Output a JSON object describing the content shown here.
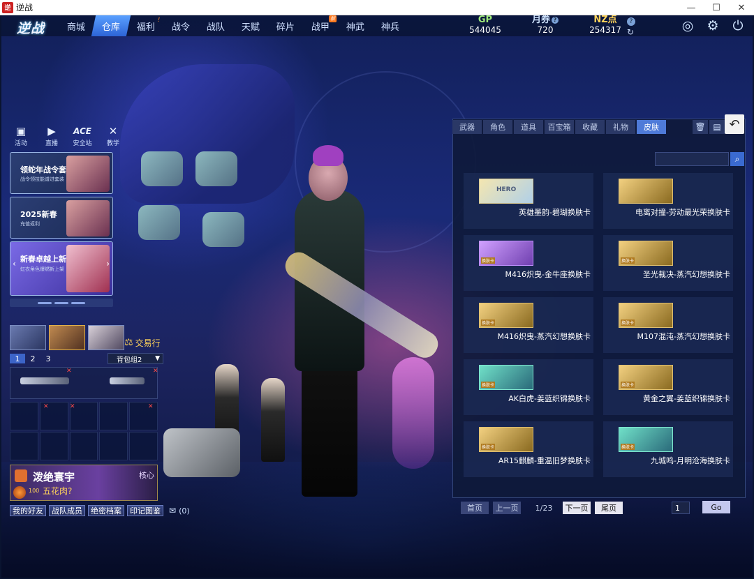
{
  "window": {
    "title": "逆战",
    "logo_glyph": "逆"
  },
  "nav": {
    "logo": "逆战",
    "tabs": [
      {
        "label": "商城"
      },
      {
        "label": "仓库"
      },
      {
        "label": "福利",
        "mark": "!"
      },
      {
        "label": "战令"
      },
      {
        "label": "战队"
      },
      {
        "label": "天赋"
      },
      {
        "label": "碎片"
      },
      {
        "label": "战甲",
        "badge": "新"
      },
      {
        "label": "神武"
      },
      {
        "label": "神兵"
      }
    ],
    "active_tab": "仓库"
  },
  "currency": {
    "gp": {
      "name": "GP",
      "value": "544045"
    },
    "monthly": {
      "name": "月券",
      "value": "720",
      "help": "?"
    },
    "nz": {
      "name": "NZ点",
      "value": "254317"
    },
    "help": "?",
    "refresh_glyph": "↻"
  },
  "top_icons": [
    "game-icon",
    "gear-icon",
    "power-icon"
  ],
  "side_icons": [
    {
      "label": "活动",
      "icon": "activity-icon"
    },
    {
      "label": "直播",
      "icon": "live-icon"
    },
    {
      "label": "安全站",
      "icon": "ace-icon",
      "glyph": "ACE"
    },
    {
      "label": "教学",
      "icon": "teach-icon"
    }
  ],
  "promos": [
    {
      "title": "领蛇年战令套装",
      "sub": "战令领技能谱进套装"
    },
    {
      "title": "2025新春",
      "sub": "充值返利"
    },
    {
      "title": "新春卓越上新",
      "sub": "虹衣角色爆燃新上架"
    }
  ],
  "loadout": {
    "trade_label": "交易行",
    "tabs": [
      "1",
      "2",
      "3"
    ],
    "active_tab": "1",
    "bag": "背包组2"
  },
  "namecard": {
    "name": "泼绝寰宇",
    "tag": "核心",
    "level": "100",
    "nick": "五花肉?"
  },
  "bottom_buttons": [
    "我的好友",
    "战队成员",
    "绝密档案",
    "印记图鉴"
  ],
  "mail_count": "(0)",
  "panel": {
    "tabs": [
      "武器",
      "角色",
      "道具",
      "百宝箱",
      "收藏",
      "礼物",
      "皮肤"
    ],
    "active_tab": "皮肤",
    "search_placeholder": "",
    "items": [
      {
        "name": "英雄墨韵-碧瑚换肤卡",
        "thumb": "hero",
        "thumb_text": "HERO"
      },
      {
        "name": "电离对撞-劳动最光荣换肤卡",
        "thumb": "gold",
        "thumb_text": ""
      },
      {
        "name": "M416炽曳-金牛座换肤卡",
        "thumb": "purple",
        "thumb_text": "换肤卡"
      },
      {
        "name": "圣光裁决-蒸汽幻想换肤卡",
        "thumb": "gold",
        "thumb_text": "换肤卡"
      },
      {
        "name": "M416炽曳-蒸汽幻想换肤卡",
        "thumb": "gold",
        "thumb_text": "换肤卡"
      },
      {
        "name": "M107混沌-蒸汽幻想换肤卡",
        "thumb": "gold",
        "thumb_text": "换肤卡"
      },
      {
        "name": "AK白虎-姜蓝织锦换肤卡",
        "thumb": "teal",
        "thumb_text": "换肤卡"
      },
      {
        "name": "黄金之翼-姜蓝织锦换肤卡",
        "thumb": "gold",
        "thumb_text": "换肤卡"
      },
      {
        "name": "AR15麒麟-重温旧梦换肤卡",
        "thumb": "gold",
        "thumb_text": "换肤卡"
      },
      {
        "name": "九城鸣-月明沧海换肤卡",
        "thumb": "teal",
        "thumb_text": "换肤卡"
      }
    ],
    "pager": {
      "first": "首页",
      "prev": "上一页",
      "page": "1/23",
      "next": "下一页",
      "last": "尾页",
      "goto_value": "1",
      "go": "Go"
    }
  }
}
